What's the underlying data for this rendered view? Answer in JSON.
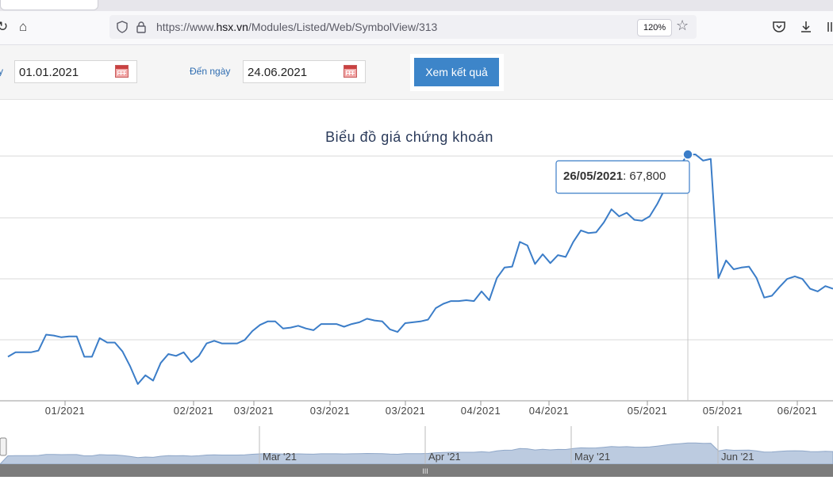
{
  "browser": {
    "url_host": "https://www.",
    "url_domain": "hsx.vn",
    "url_path": "/Modules/Listed/Web/SymbolView/313",
    "zoom": "120%"
  },
  "form": {
    "from_label": "y",
    "from_date": "01.01.2021",
    "to_label": "Đến ngày",
    "to_date": "24.06.2021",
    "submit_label": "Xem kết quả"
  },
  "chart_data": {
    "type": "line",
    "title": "Biểu đồ giá chứng khoán",
    "xlabel": "",
    "ylabel": "",
    "color": "#3b7dc8",
    "x_tick_labels": [
      "01/2021",
      "02/2021",
      "03/2021",
      "03/2021",
      "03/2021",
      "04/2021",
      "04/2021",
      "05/2021",
      "05/2021",
      "06/2021"
    ],
    "navigator_labels": [
      "Mar '21",
      "Apr '21",
      "May '21",
      "Jun '21"
    ],
    "grid": true,
    "tooltip": {
      "date": "26/05/2021",
      "value": "67,800"
    },
    "series": [
      {
        "values": [
          44900,
          45400,
          45400,
          45400,
          45600,
          47400,
          47300,
          47100,
          47200,
          47200,
          44900,
          44900,
          47000,
          46500,
          46500,
          45500,
          43800,
          41800,
          42800,
          42200,
          44200,
          45200,
          45000,
          45400,
          44300,
          45000,
          46400,
          46700,
          46400,
          46400,
          46400,
          46800,
          47800,
          48500,
          48900,
          48900,
          48100,
          48200,
          48400,
          48100,
          47900,
          48600,
          48600,
          48600,
          48300,
          48600,
          48800,
          49200,
          49000,
          48900,
          48000,
          47700,
          48700,
          48800,
          48900,
          49100,
          50400,
          50900,
          51200,
          51200,
          51300,
          51200,
          52300,
          51300,
          53800,
          55000,
          55100,
          57900,
          57500,
          55400,
          56500,
          55500,
          56400,
          56200,
          57900,
          59200,
          58900,
          59000,
          60100,
          61600,
          60800,
          61200,
          60400,
          60300,
          60800,
          62200,
          63900,
          65600,
          66600,
          67800,
          67800,
          67100,
          67300,
          53800,
          55800,
          54800,
          55000,
          55100,
          53800,
          51600,
          51800,
          52800,
          53700,
          54000,
          53700,
          52600,
          52300,
          52900,
          52600
        ]
      }
    ]
  }
}
